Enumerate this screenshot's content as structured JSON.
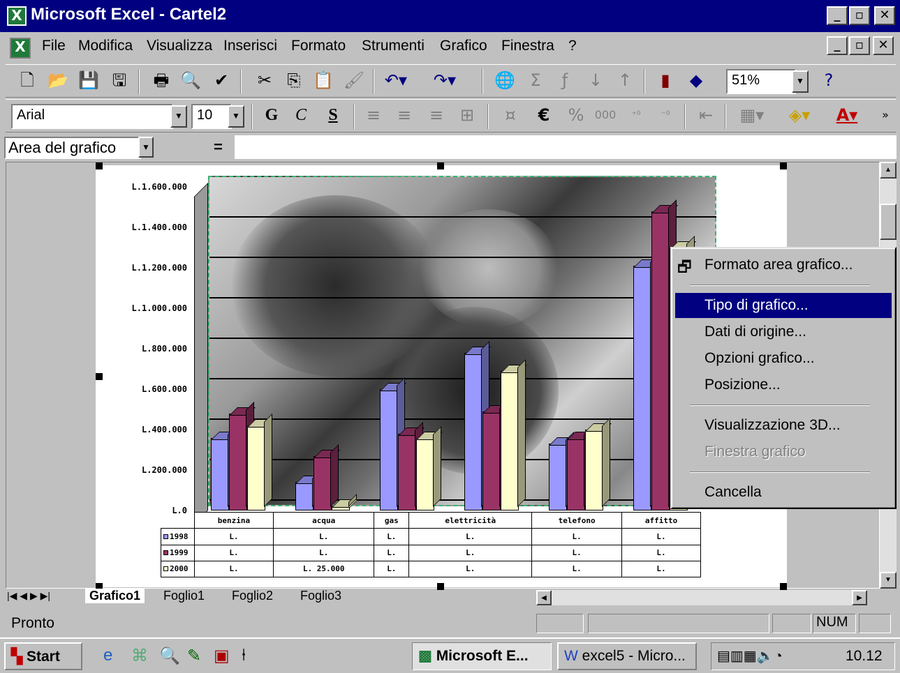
{
  "window": {
    "title": "Microsoft Excel - Cartel2"
  },
  "menu": [
    "File",
    "Modifica",
    "Visualizza",
    "Inserisci",
    "Formato",
    "Strumenti",
    "Grafico",
    "Finestra",
    "?"
  ],
  "toolbar": {
    "zoom": "51%",
    "font": "Arial",
    "size": "10",
    "bold": "G",
    "italic": "C",
    "underline": "S",
    "euro": "€",
    "percent": "%",
    "thousands": "000"
  },
  "formula": {
    "namebox": "Area del grafico",
    "equals": "="
  },
  "chart_data": {
    "type": "bar",
    "categories": [
      "benzina",
      "acqua",
      "gas",
      "elettricità",
      "telefono",
      "affitto"
    ],
    "series": [
      {
        "name": "1998",
        "color": "#9999ff",
        "values": [
          360000,
          140000,
          600000,
          780000,
          330000,
          1210000
        ]
      },
      {
        "name": "1999",
        "color": "#993366",
        "values": [
          480000,
          270000,
          380000,
          490000,
          360000,
          1480000
        ]
      },
      {
        "name": "2000",
        "color": "#ffffcc",
        "values": [
          420000,
          25000,
          360000,
          690000,
          400000,
          1300000
        ]
      }
    ],
    "yticks": [
      "L.0",
      "L.200.000",
      "L.400.000",
      "L.600.000",
      "L.800.000",
      "L.1.000.000",
      "L.1.200.000",
      "L.1.400.000",
      "L.1.600.000"
    ],
    "ylim": [
      0,
      1600000
    ],
    "table": {
      "1998": [
        "L.",
        "L.",
        "L.",
        "L.",
        "L.",
        "L."
      ],
      "1999": [
        "L.",
        "L.",
        "L.",
        "L.",
        "L.",
        "L."
      ],
      "2000": [
        "L.",
        "L. 25.000",
        "L.",
        "L.",
        "L.",
        "L."
      ]
    }
  },
  "context_menu": [
    {
      "label": "Formato area grafico...",
      "state": "normal"
    },
    {
      "label": "Tipo di grafico...",
      "state": "selected"
    },
    {
      "label": "Dati di origine...",
      "state": "normal"
    },
    {
      "label": "Opzioni grafico...",
      "state": "normal"
    },
    {
      "label": "Posizione...",
      "state": "normal"
    },
    {
      "label": "Visualizzazione 3D...",
      "state": "normal"
    },
    {
      "label": "Finestra grafico",
      "state": "disabled"
    },
    {
      "label": "Cancella",
      "state": "normal"
    }
  ],
  "tabs": [
    "Grafico1",
    "Foglio1",
    "Foglio2",
    "Foglio3"
  ],
  "status": {
    "text": "Pronto",
    "num": "NUM"
  },
  "taskbar": {
    "start": "Start",
    "task1": "Microsoft E...",
    "task2": "excel5 - Micro...",
    "clock": "10.12"
  }
}
